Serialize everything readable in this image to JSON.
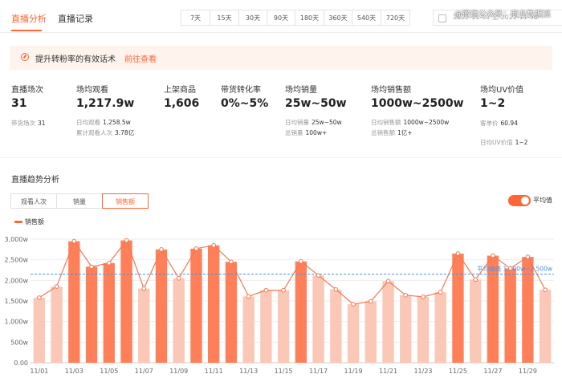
{
  "tabs": [
    "直播分析",
    "直播记录"
  ],
  "range_buttons": [
    "7天",
    "15天",
    "30天",
    "90天",
    "180天",
    "360天",
    "540天",
    "720天"
  ],
  "date_range": "2022-11-01  至  2022-11-30",
  "watermark": "@微信公众号：商业数据派",
  "tip": {
    "text": "提升转粉率的有效话术",
    "link": "前往查看"
  },
  "metrics": [
    {
      "label": "直播场次",
      "value": "31",
      "subs": [
        [
          "带货场次",
          "31"
        ]
      ]
    },
    {
      "label": "场均观看",
      "value": "1,217.9w",
      "subs": [
        [
          "日均观看",
          "1,258.5w"
        ],
        [
          "累计观看人次",
          "3.78亿"
        ]
      ]
    },
    {
      "label": "上架商品",
      "value": "1,606",
      "subs": []
    },
    {
      "label": "带货转化率",
      "value": "0%~5%",
      "subs": []
    },
    {
      "label": "场均销量",
      "value": "25w~50w",
      "subs": [
        [
          "日均销量",
          "25w~50w"
        ],
        [
          "总销量",
          "100w+"
        ]
      ]
    },
    {
      "label": "场均销售额",
      "value": "1000w~2500w",
      "subs": [
        [
          "日均销售额",
          "1000w~2500w"
        ],
        [
          "总销售额",
          "1亿+"
        ]
      ]
    },
    {
      "label": "场均UV价值",
      "value": "1~2",
      "subs": [
        [
          "客单价",
          "60.94"
        ],
        [
          "日均UV价值",
          "1~2"
        ]
      ]
    }
  ],
  "trend": {
    "title": "直播趋势分析",
    "segments": [
      "观看人次",
      "销量",
      "销售额"
    ],
    "active_segment": "销售额",
    "toggle_label": "平均值",
    "legend": "销售额"
  },
  "colors": {
    "accent": "#ff6633",
    "bar_dark": "#ff7f59",
    "bar_light": "#fbc7b6",
    "line": "#f07a55",
    "avg": "#4a90e2"
  },
  "chart_data": {
    "type": "bar",
    "title": "",
    "ylim": [
      0,
      3000
    ],
    "yticks": [
      "0.00",
      "500w",
      "1,000w",
      "1,500w",
      "2,000w",
      "2,500w",
      "3,000w"
    ],
    "categories": [
      "11/01",
      "11/02",
      "11/03",
      "11/04",
      "11/05",
      "11/06",
      "11/07",
      "11/08",
      "11/09",
      "11/10",
      "11/11",
      "11/12",
      "11/13",
      "11/14",
      "11/15",
      "11/16",
      "11/17",
      "11/18",
      "11/19",
      "11/20",
      "11/21",
      "11/22",
      "11/23",
      "11/24",
      "11/25",
      "11/26",
      "11/27",
      "11/28",
      "11/29",
      "11/30"
    ],
    "xtick_labels": [
      "11/01",
      "",
      "11/03",
      "",
      "11/05",
      "",
      "11/07",
      "",
      "11/09",
      "",
      "11/11",
      "",
      "11/13",
      "",
      "11/15",
      "",
      "11/17",
      "",
      "11/19",
      "",
      "11/21",
      "",
      "11/23",
      "",
      "11/25",
      "",
      "11/27",
      "",
      "11/29",
      ""
    ],
    "series": [
      {
        "name": "销售额",
        "values": [
          1580,
          1850,
          2950,
          2330,
          2420,
          2970,
          1800,
          2750,
          2050,
          2770,
          2850,
          2450,
          1610,
          1760,
          1760,
          2460,
          2120,
          1780,
          1420,
          1490,
          1980,
          1640,
          1600,
          1710,
          2650,
          2020,
          2600,
          2290,
          2570,
          1770
        ]
      }
    ],
    "bar_style": [
      "light",
      "light",
      "dark",
      "dark",
      "dark",
      "dark",
      "light",
      "dark",
      "light",
      "dark",
      "dark",
      "dark",
      "light",
      "light",
      "light",
      "dark",
      "light",
      "light",
      "light",
      "light",
      "light",
      "light",
      "light",
      "light",
      "dark",
      "light",
      "dark",
      "dark",
      "dark",
      "light"
    ],
    "average": {
      "value": 2150,
      "label": "平均值线 1,000w~2,500w"
    },
    "grid": true,
    "legend": "top-left"
  }
}
